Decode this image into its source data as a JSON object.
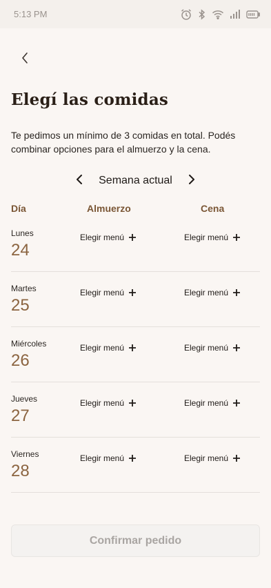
{
  "status_bar": {
    "time": "5:13 PM",
    "icons": [
      "alarm-icon",
      "bluetooth-icon",
      "wifi-icon",
      "signal-icon",
      "battery-icon"
    ]
  },
  "header": {
    "back_icon": "chevron-left-icon",
    "title": "Elegí las comidas",
    "subtitle": "Te pedimos un mínimo de 3 comidas en total. Podés combinar opciones para el almuerzo y la cena."
  },
  "week": {
    "label": "Semana actual",
    "prev_icon": "chevron-left-icon",
    "next_icon": "chevron-right-icon"
  },
  "table": {
    "headers": {
      "day": "Día",
      "lunch": "Almuerzo",
      "dinner": "Cena"
    },
    "rows": [
      {
        "day": "Lunes",
        "date": "24",
        "lunch": "Elegir menú",
        "dinner": "Elegir menú"
      },
      {
        "day": "Martes",
        "date": "25",
        "lunch": "Elegir menú",
        "dinner": "Elegir menú"
      },
      {
        "day": "Miércoles",
        "date": "26",
        "lunch": "Elegir menú",
        "dinner": "Elegir menú"
      },
      {
        "day": "Jueves",
        "date": "27",
        "lunch": "Elegir menú",
        "dinner": "Elegir menú"
      },
      {
        "day": "Viernes",
        "date": "28",
        "lunch": "Elegir menú",
        "dinner": "Elegir menú"
      }
    ]
  },
  "footer": {
    "confirm_label": "Confirmar pedido",
    "confirm_enabled": false
  },
  "colors": {
    "background": "#faf6f3",
    "accent_brown": "#8b6440",
    "header_brown": "#7a5635",
    "title": "#2a1f17",
    "disabled_text": "#a9a5a2"
  }
}
